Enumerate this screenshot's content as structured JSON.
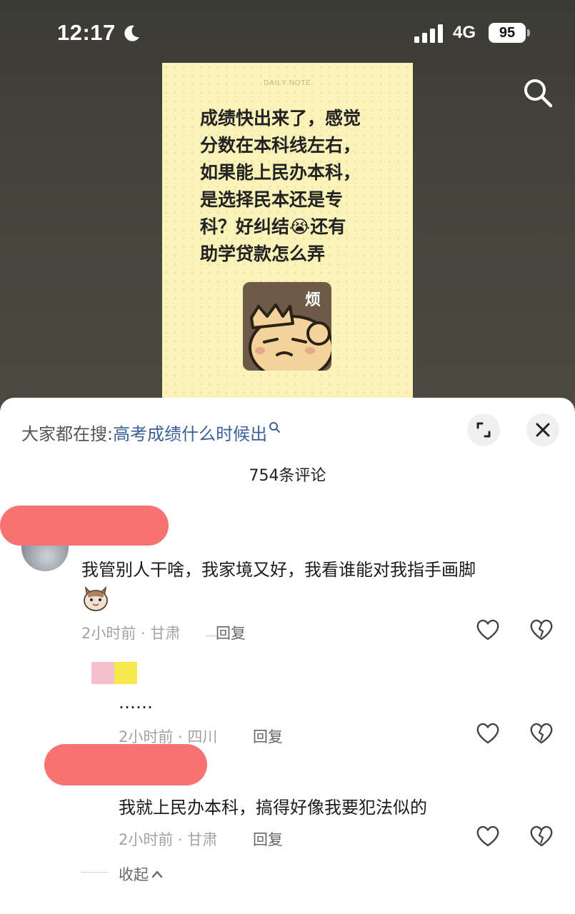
{
  "status_bar": {
    "time": "12:17",
    "network": "4G",
    "battery": "95"
  },
  "note": {
    "header": "DAILY NOTE",
    "lines": [
      "成绩快出来了，感觉",
      "分数在本科线左右，",
      "如果能上民办本科，",
      "是选择民本还是专",
      "科？好纠结😭还有",
      "助学贷款怎么弄"
    ],
    "sticker_label": "烦"
  },
  "sheet": {
    "hot_search_prefix": "大家都在搜:",
    "hot_search_query": "高考成绩什么时候出",
    "comment_count": "754条评论"
  },
  "comments": [
    {
      "text": "我管别人干啥，我家境又好，我看谁能对我指手画脚",
      "meta": "2小时前 · 甘肃",
      "reply": "回复"
    },
    {
      "text": "……",
      "meta": "2小时前 · 四川",
      "reply": "回复"
    },
    {
      "text": "我就上民办本科，搞得好像我要犯法似的",
      "meta": "2小时前 · 甘肃",
      "reply": "回复"
    }
  ],
  "collapse_label": "收起",
  "colors": {
    "link": "#3a5f99",
    "redaction": "#f77373",
    "note_bg": "#f9f3b9"
  },
  "icons": [
    "moon-icon",
    "signal-icon",
    "search-icon",
    "expand-icon",
    "close-icon",
    "heart-icon",
    "dislike-icon",
    "chevron-up-icon"
  ]
}
